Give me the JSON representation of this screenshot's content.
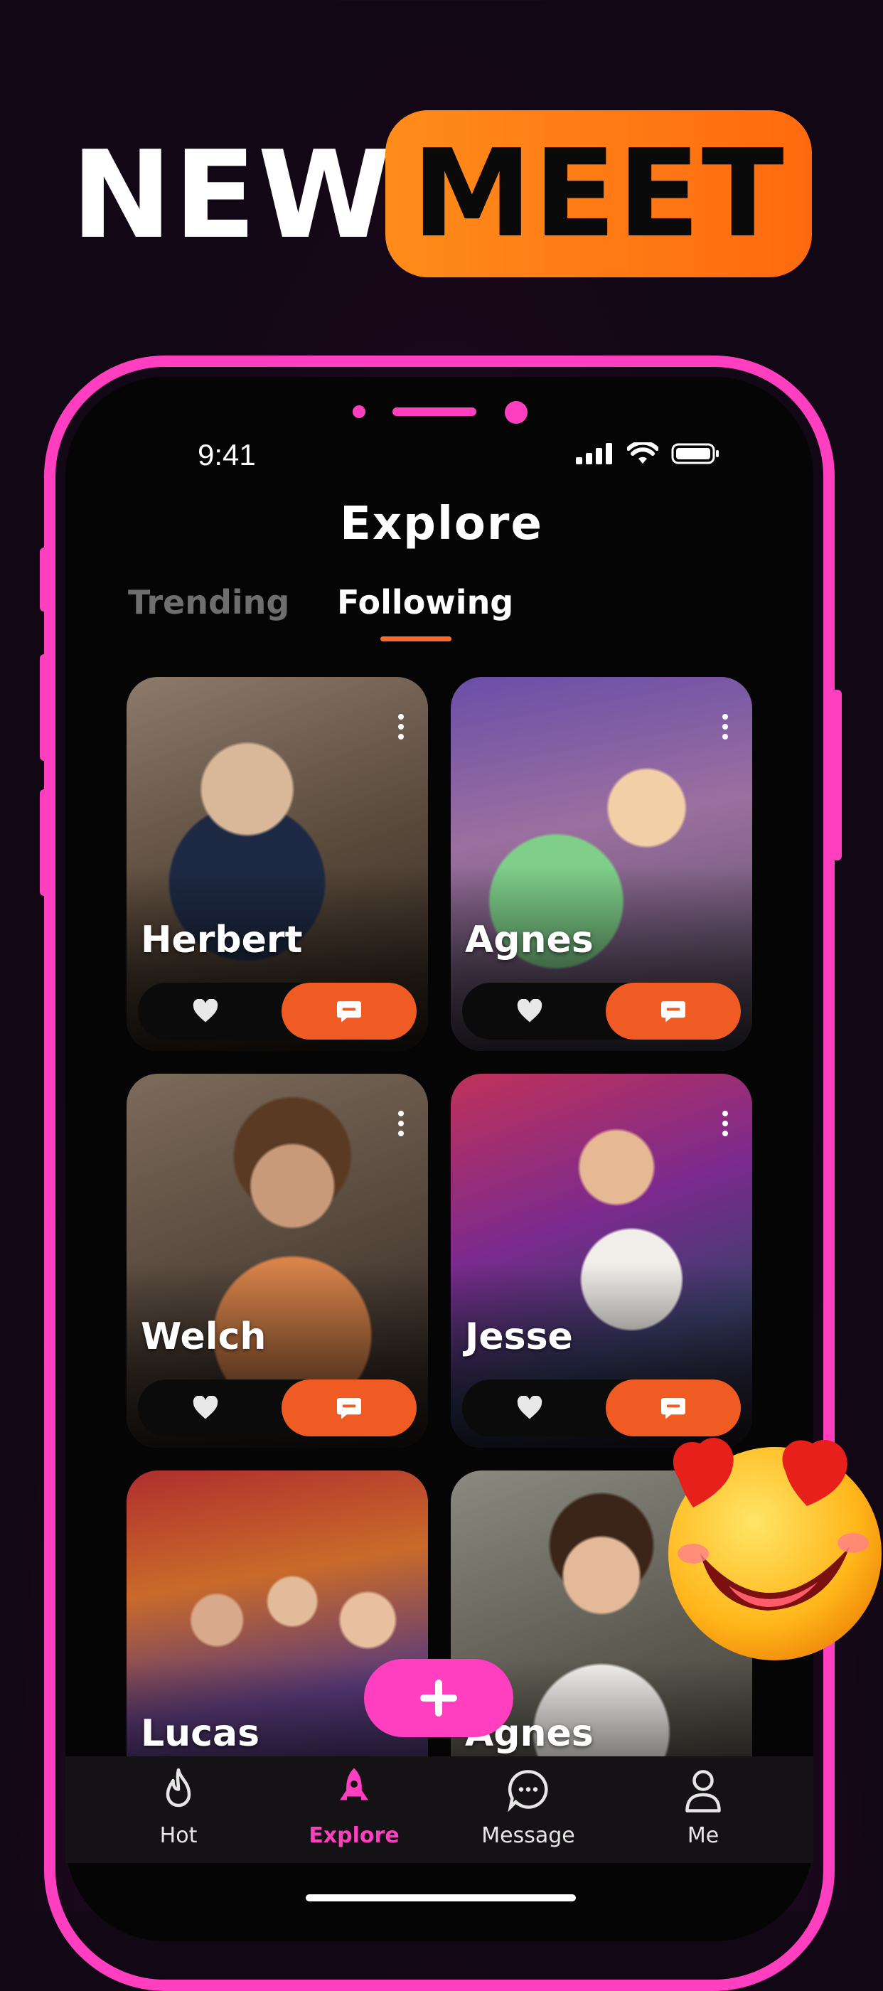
{
  "banner": {
    "word1": "NEW",
    "word2": "MEET"
  },
  "status_bar": {
    "time": "9:41"
  },
  "page": {
    "title": "Explore"
  },
  "tabs": [
    {
      "label": "Trending",
      "active": false
    },
    {
      "label": "Following",
      "active": true
    }
  ],
  "cards": [
    {
      "name": "Herbert"
    },
    {
      "name": "Agnes"
    },
    {
      "name": "Welch"
    },
    {
      "name": "Jesse"
    },
    {
      "name": "Lucas"
    },
    {
      "name": "Agnes"
    }
  ],
  "nav": [
    {
      "label": "Hot",
      "icon": "flame-icon"
    },
    {
      "label": "Explore",
      "icon": "rocket-icon",
      "active": true
    },
    {
      "label": "Message",
      "icon": "chat-bubble-icon"
    },
    {
      "label": "Me",
      "icon": "person-icon"
    }
  ],
  "colors": {
    "accent_pink": "#ff3fbf",
    "accent_orange": "#f05a23",
    "banner_orange": "#ff7a14",
    "background": "#050505"
  }
}
